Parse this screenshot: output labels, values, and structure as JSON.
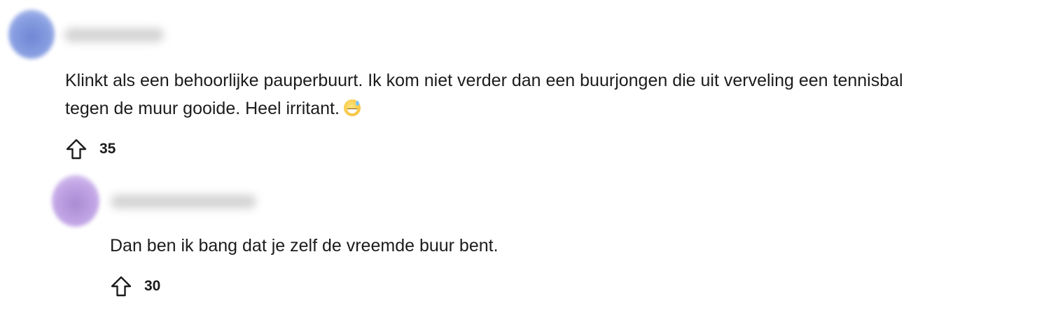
{
  "comments": [
    {
      "text_line1": "Klinkt als een behoorlijke pauperbuurt. Ik kom niet verder dan een buurjongen die uit verveling een tennisbal",
      "text_line2": "tegen de muur gooide. Heel irritant.",
      "emoji": "grinning-face-with-sweat",
      "upvotes": "35",
      "avatar_color": "#7f95dc"
    },
    {
      "text": "Dan ben ik bang dat je zelf de vreemde buur bent.",
      "upvotes": "30",
      "avatar_color": "#b697dd"
    }
  ],
  "icons": {
    "upvote": "upvote-arrow-icon"
  }
}
